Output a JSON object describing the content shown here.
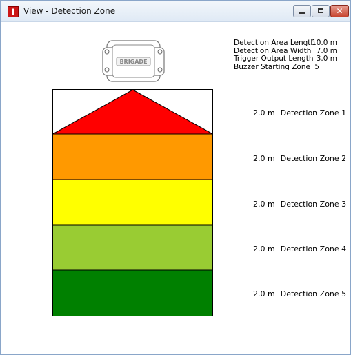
{
  "window": {
    "title": "View - Detection Zone",
    "icon": "info-app-icon",
    "controls": {
      "minimize": "minimize-icon",
      "maximize": "maximize-icon",
      "close": "close-icon"
    }
  },
  "device": {
    "brand": "BRIGADE",
    "icon": "sensor-device-icon"
  },
  "specs": [
    {
      "label": "Detection Area Length",
      "value": "10.0 m"
    },
    {
      "label": "Detection Area Width",
      "value": "7.0 m"
    },
    {
      "label": "Trigger Output Length",
      "value": "3.0 m"
    },
    {
      "label": "Buzzer Starting Zone",
      "value": "5"
    }
  ],
  "zones": [
    {
      "length": "2.0 m",
      "name": "Detection Zone 1",
      "color": "#ff0000"
    },
    {
      "length": "2.0 m",
      "name": "Detection Zone 2",
      "color": "#ff9900"
    },
    {
      "length": "2.0 m",
      "name": "Detection Zone 3",
      "color": "#ffff00"
    },
    {
      "length": "2.0 m",
      "name": "Detection Zone 4",
      "color": "#99cc33"
    },
    {
      "length": "2.0 m",
      "name": "Detection Zone 5",
      "color": "#008000"
    }
  ]
}
